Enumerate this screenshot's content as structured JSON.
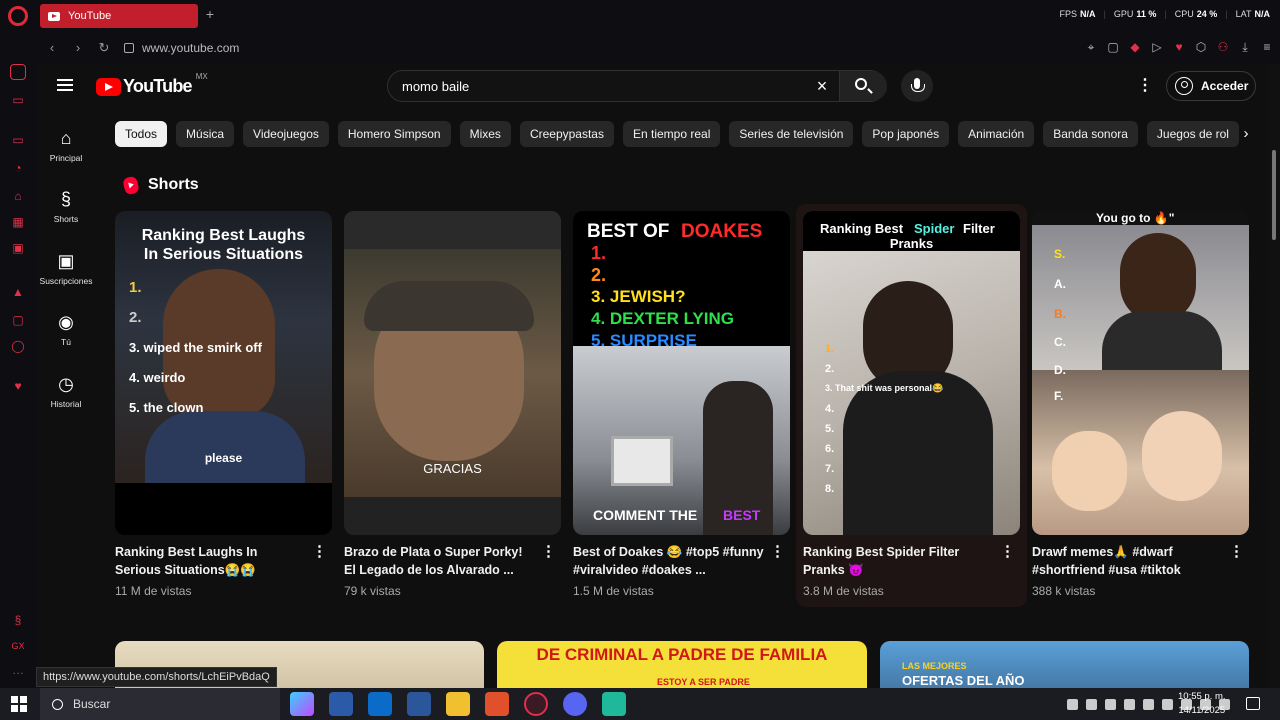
{
  "browser": {
    "tab_title": "YouTube",
    "url": "www.youtube.com",
    "stats": [
      {
        "label": "FPS",
        "value": "N/A"
      },
      {
        "label": "GPU",
        "value": "11 %"
      },
      {
        "label": "CPU",
        "value": "24 %"
      },
      {
        "label": "LAT",
        "value": "N/A"
      }
    ],
    "status_url": "https://www.youtube.com/shorts/LchEiPvBdaQ"
  },
  "header": {
    "logo_text": "YouTube",
    "region": "MX",
    "search_value": "momo baile",
    "signin_label": "Acceder"
  },
  "rail": [
    {
      "label": "Principal",
      "icon": "home-icon"
    },
    {
      "label": "Shorts",
      "icon": "shorts-icon"
    },
    {
      "label": "Suscripciones",
      "icon": "subscriptions-icon"
    },
    {
      "label": "Tú",
      "icon": "you-icon"
    },
    {
      "label": "Historial",
      "icon": "history-icon"
    }
  ],
  "chips": [
    "Todos",
    "Música",
    "Videojuegos",
    "Homero Simpson",
    "Mixes",
    "Creepypastas",
    "En tiempo real",
    "Series de televisión",
    "Pop japonés",
    "Animación",
    "Banda sonora",
    "Juegos de rol"
  ],
  "shorts": {
    "section_title": "Shorts",
    "items": [
      {
        "title": "Ranking Best Laughs In Serious Situations😭😭",
        "views": "11 M de vistas"
      },
      {
        "title": "Brazo de Plata o Super Porky! El Legado de los Alvarado ...",
        "views": "79 k vistas"
      },
      {
        "title": "Best of Doakes 😂 #top5 #funny #viralvideo #doakes ...",
        "views": "1.5 M de vistas"
      },
      {
        "title": "Ranking Best Spider Filter Pranks 😈",
        "views": "3.8 M de vistas"
      },
      {
        "title": "Drawf memes🙏 #dwarf #shortfriend #usa #tiktok",
        "views": "388 k vistas"
      }
    ],
    "thumb1": {
      "line1": "Ranking Best Laughs",
      "line2": "In Serious Situations",
      "r1": "1.",
      "r2": "2.",
      "r3": "3. wiped the smirk off",
      "r4": "4. weirdo",
      "r5": "5. the clown",
      "caption": "please"
    },
    "thumb2": {
      "caption": "GRACIAS"
    },
    "thumb3": {
      "head1": "BEST OF",
      "head2": "DOAKES",
      "r1": "1.",
      "r2": "2.",
      "r3": "3. JEWISH?",
      "r4": "4. DEXTER LYING",
      "r5": "5. SURPRISE",
      "caption1": "COMMENT THE",
      "caption2": "BEST"
    },
    "thumb4": {
      "line1a": "Ranking Best",
      "line1b": "Spider",
      "line1c": "Filter",
      "line2": "Pranks",
      "nums": [
        "1.",
        "2.",
        "3. That shit was personal😂",
        "4.",
        "5.",
        "6.",
        "7.",
        "8."
      ]
    },
    "thumb5": {
      "top": "You go to 🔥\"",
      "tiers": [
        "S.",
        "A.",
        "B.",
        "C.",
        "D.",
        "F."
      ]
    }
  },
  "bottom": {
    "banner_text": "DE CRIMINAL A PADRE DE FAMILIA",
    "banner_sub": "ESTOY A SER PADRE",
    "offers_text": "LAS MEJORES",
    "offers_text2": "OFERTAS DEL AÑO"
  },
  "taskbar": {
    "search_label": "Buscar",
    "time": "10:55 p. m.",
    "date": "14/11/2025"
  }
}
